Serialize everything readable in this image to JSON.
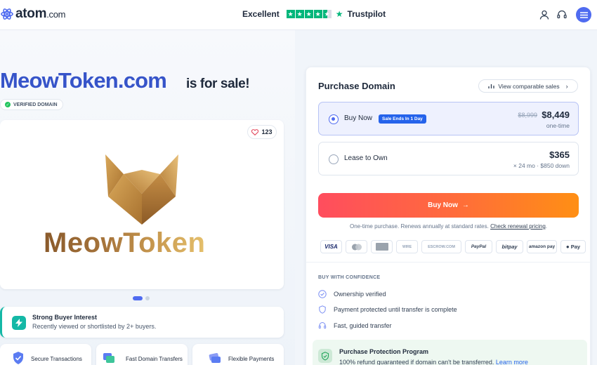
{
  "header": {
    "logo_word": "atom",
    "logo_suffix": ".com",
    "rating_label": "Excellent",
    "rating_source": "Trustpilot",
    "rating_stars": 4.5
  },
  "listing": {
    "domain": "MeowToken.com",
    "for_sale": "is for sale!",
    "verified_badge": "VERIFIED DOMAIN",
    "likes": "123",
    "logo_text": "MeowToken",
    "carousel_count": 2,
    "carousel_active": 1
  },
  "interest": {
    "title": "Strong Buyer Interest",
    "subtitle": "Recently viewed or shortlisted by 2+ buyers."
  },
  "features": [
    {
      "label": "Secure Transactions",
      "icon": "shield-check-icon"
    },
    {
      "label": "Fast Domain Transfers",
      "icon": "transfer-icon"
    },
    {
      "label": "Flexible Payments",
      "icon": "cards-icon"
    }
  ],
  "purchase": {
    "title": "Purchase Domain",
    "comparable_link": "View comparable sales",
    "options": [
      {
        "label": "Buy Now",
        "badge": "Sale Ends In 1 Day",
        "old_price": "$8,999",
        "price": "$8,449",
        "note": "one-time",
        "selected": true
      },
      {
        "label": "Lease to Own",
        "price": "$365",
        "note": "× 24 mo · $850 down",
        "selected": false
      }
    ],
    "button": "Buy Now",
    "renew_text": "One-time purchase. Renews annually at standard rates.",
    "renew_link": "Check renewal pricing",
    "renew_end": "."
  },
  "payments": [
    "VISA",
    "Mastercard",
    "AMEX",
    "WIRE",
    "ESCROW.COM",
    "PayPal",
    "bitpay",
    "amazon pay",
    "Pay"
  ],
  "confidence": {
    "heading": "BUY WITH CONFIDENCE",
    "items": [
      "Ownership verified",
      "Payment protected until transfer is complete",
      "Fast, guided transfer"
    ]
  },
  "protection": {
    "title": "Purchase Protection Program",
    "text": "100% refund guaranteed if domain can't be transferred.",
    "link": "Learn more"
  },
  "colors": {
    "accent": "#4f6bf0",
    "domain_blue": "#3654c9",
    "trustpilot_green": "#00b67a",
    "cta_start": "#ff4d5e",
    "cta_end": "#ff8f14",
    "teal": "#14b8a6"
  }
}
